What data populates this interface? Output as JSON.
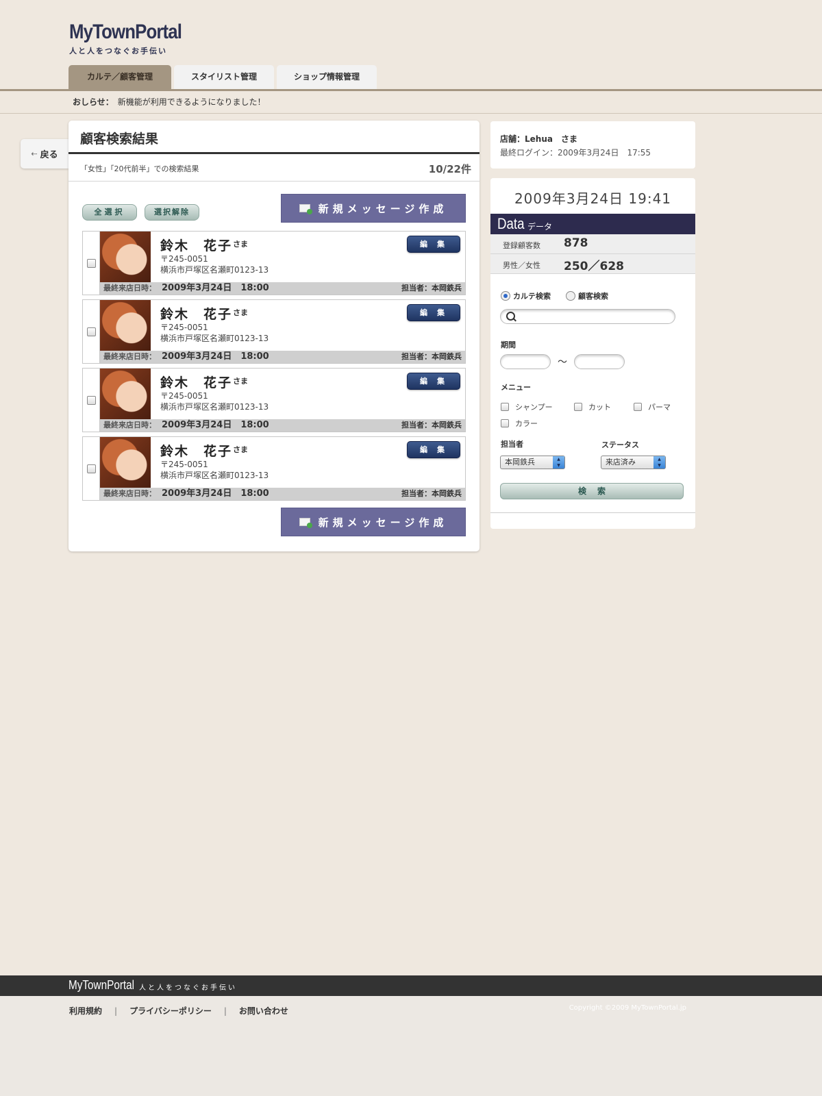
{
  "header": {
    "logo": "MyTownPortal",
    "tagline": "人と人をつなぐお手伝い",
    "tabs": [
      "カルテ／顧客管理",
      "スタイリスト管理",
      "ショップ情報管理"
    ],
    "notice_label": "おしらせ：",
    "notice_text": "新機能が利用できるようになりました！"
  },
  "back_label": "戻る",
  "main": {
    "title": "顧客検索結果",
    "conditions": "「女性」「20代前半」での検索結果",
    "count": "10/22件",
    "select_all": "全選択",
    "deselect": "選択解除",
    "compose": "新規メッセージ作成",
    "customers": [
      {
        "name": "鈴木　花子",
        "honorific": "さま",
        "zip": "〒245-0051",
        "address": "横浜市戸塚区名瀬町0123-13",
        "edit": "編集",
        "last_visit_label": "最終来店日時：",
        "last_visit": "2009年3月24日　18:00",
        "staff": "担当者：本岡鉄兵"
      },
      {
        "name": "鈴木　花子",
        "honorific": "さま",
        "zip": "〒245-0051",
        "address": "横浜市戸塚区名瀬町0123-13",
        "edit": "編集",
        "last_visit_label": "最終来店日時：",
        "last_visit": "2009年3月24日　18:00",
        "staff": "担当者：本岡鉄兵"
      },
      {
        "name": "鈴木　花子",
        "honorific": "さま",
        "zip": "〒245-0051",
        "address": "横浜市戸塚区名瀬町0123-13",
        "edit": "編集",
        "last_visit_label": "最終来店日時：",
        "last_visit": "2009年3月24日　18:00",
        "staff": "担当者：本岡鉄兵"
      },
      {
        "name": "鈴木　花子",
        "honorific": "さま",
        "zip": "〒245-0051",
        "address": "横浜市戸塚区名瀬町0123-13",
        "edit": "編集",
        "last_visit_label": "最終来店日時：",
        "last_visit": "2009年3月24日　18:00",
        "staff": "担当者：本岡鉄兵"
      }
    ]
  },
  "side": {
    "shop": "店舗：Lehua　さま",
    "last_login": "最終ログイン：2009年3月24日　17:55",
    "datetime": "2009年3月24日 19:41",
    "data_title": "Data",
    "data_sub": "データ",
    "stats": [
      {
        "label": "登録顧客数",
        "value": "878"
      },
      {
        "label": "男性／女性",
        "value": "250／628"
      }
    ],
    "radio_karte": "カルテ検索",
    "radio_customer": "顧客検索",
    "search_placeholder": "",
    "period_label": "期間",
    "tilde": "～",
    "menu_label": "メニュー",
    "menu_items": [
      "シャンプー",
      "カット",
      "パーマ",
      "カラー"
    ],
    "staff_label": "担当者",
    "staff_value": "本岡鉄兵",
    "status_label": "ステータス",
    "status_value": "来店済み",
    "search_button": "検索"
  },
  "footer": {
    "logo": "MyTownPortal",
    "tagline": "人と人をつなぐお手伝い",
    "links": [
      "利用規約",
      "プライバシーポリシー",
      "お問い合わせ"
    ],
    "separator": "|",
    "copyright": "Copyright ©2009 MyTownPortal.jp"
  }
}
